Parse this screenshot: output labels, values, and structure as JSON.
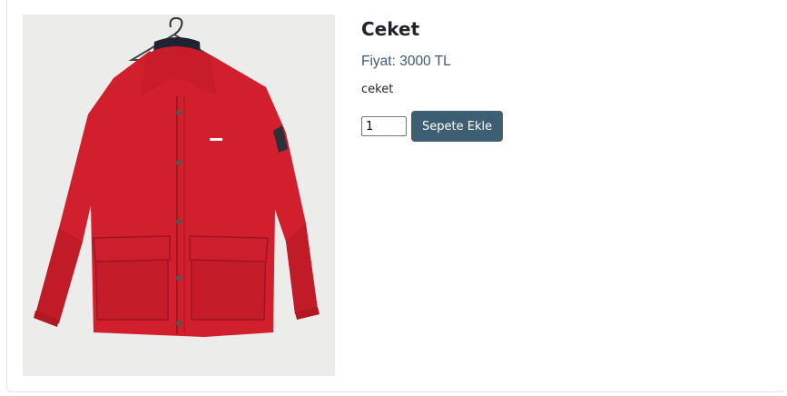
{
  "product": {
    "title": "Ceket",
    "price": "Fiyat: 3000 TL",
    "description": "ceket",
    "image_subject": "red-jacket-on-hanger"
  },
  "cart": {
    "quantity": "1",
    "add_label": "Sepete Ekle"
  },
  "colors": {
    "button": "#3e5f73",
    "price_text": "#3d5a73",
    "jacket": "#d0202e"
  }
}
